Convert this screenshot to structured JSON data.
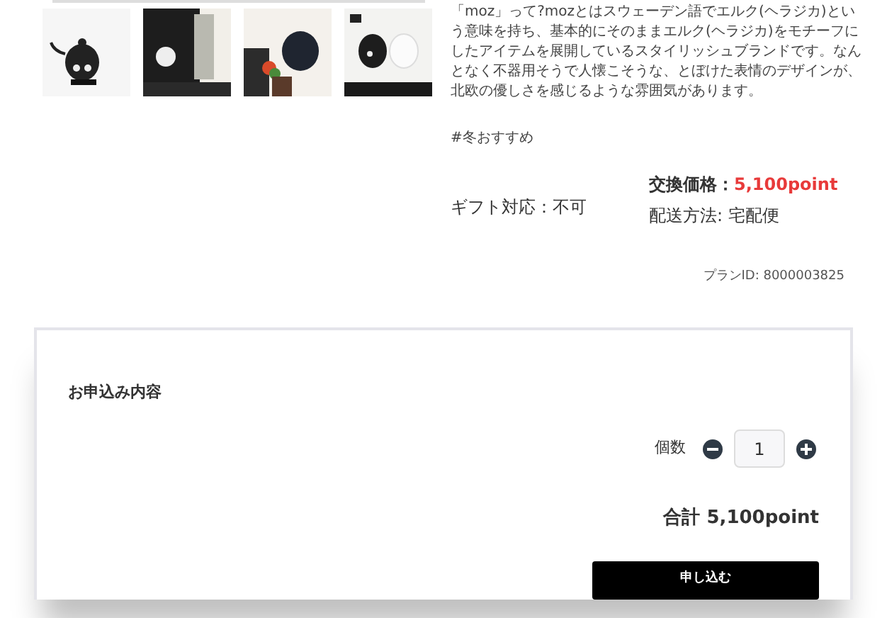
{
  "description": "「moz」って?mozとはスウェーデン語でエルク(ヘラジカ)という意味を持ち、基本的にそのままエルク(ヘラジカ)をモチーフにしたアイテムを展開しているスタイリッシュブランドです。なんとなく不器用そうで人懐こそうな、とぼけた表情のデザインが、北欧の優しさを感じるような雰囲気があります。",
  "tag": "#冬おすすめ",
  "gift": "ギフト対応：不可",
  "price_label": "交換価格：",
  "price_value": "5,100point",
  "delivery": "配送方法: 宅配便",
  "plan_id": "プランID: 8000003825",
  "order": {
    "title": "お申込み内容",
    "quantity_label": "個数",
    "quantity": "1",
    "total": "合計 5,100point",
    "submit": "申し込む"
  }
}
